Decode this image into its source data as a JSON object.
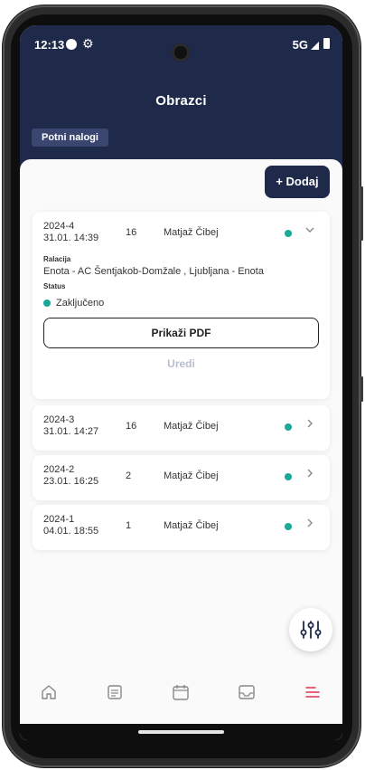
{
  "status_bar": {
    "time": "12:13",
    "network": "5G"
  },
  "header": {
    "title": "Obrazci",
    "chip": "Potni nalogi"
  },
  "toolbar": {
    "add_label": "+ Dodaj"
  },
  "records": [
    {
      "id": "2024-4",
      "datetime": "31.01. 14:39",
      "count": "16",
      "person": "Matjaž Čibej",
      "expanded": true,
      "relation_label": "Ralacija",
      "relation_value": "Enota - AC Šentjakob-Domžale , Ljubljana - Enota",
      "status_label": "Status",
      "status_value": "Zaključeno",
      "pdf_label": "Prikaži PDF",
      "edit_label": "Uredi"
    },
    {
      "id": "2024-3",
      "datetime": "31.01. 14:27",
      "count": "16",
      "person": "Matjaž Čibej",
      "expanded": false
    },
    {
      "id": "2024-2",
      "datetime": "23.01. 16:25",
      "count": "2",
      "person": "Matjaž Čibej",
      "expanded": false
    },
    {
      "id": "2024-1",
      "datetime": "04.01. 18:55",
      "count": "1",
      "person": "Matjaž Čibej",
      "expanded": false
    }
  ],
  "colors": {
    "header_bg": "#1f2a4b",
    "chip_bg": "#3a4670",
    "status_active": "#1aa898",
    "nav_active": "#e0324f",
    "disabled_text": "#b9bdd0"
  },
  "bottom_nav": [
    {
      "icon": "home-icon",
      "active": false
    },
    {
      "icon": "form-icon",
      "active": false
    },
    {
      "icon": "calendar-icon",
      "active": false
    },
    {
      "icon": "inbox-icon",
      "active": false
    },
    {
      "icon": "menu-icon",
      "active": true
    }
  ],
  "fab": {
    "icon": "filter-sliders-icon"
  }
}
